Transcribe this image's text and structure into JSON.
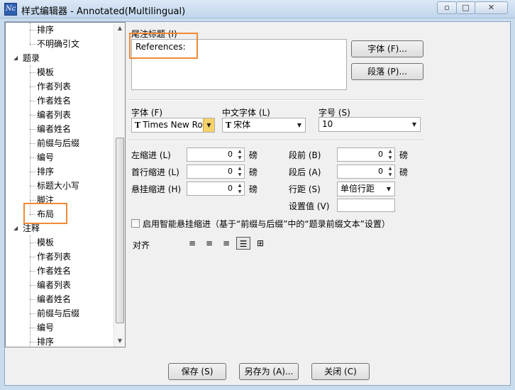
{
  "window": {
    "title": "样式编辑器 - Annotated(Multilingual)",
    "min_label": "▭",
    "max_label": "□",
    "close_label": "✕"
  },
  "tree": {
    "items": [
      {
        "label": "排序",
        "level": 2
      },
      {
        "label": "不明确引文",
        "level": 2
      },
      {
        "label": "题录",
        "level": 1
      },
      {
        "label": "模板",
        "level": 2
      },
      {
        "label": "作者列表",
        "level": 2
      },
      {
        "label": "作者姓名",
        "level": 2
      },
      {
        "label": "编者列表",
        "level": 2
      },
      {
        "label": "编者姓名",
        "level": 2
      },
      {
        "label": "前缀与后缀",
        "level": 2
      },
      {
        "label": "编号",
        "level": 2
      },
      {
        "label": "排序",
        "level": 2
      },
      {
        "label": "标题大小写",
        "level": 2
      },
      {
        "label": "脚注",
        "level": 2
      },
      {
        "label": "布局",
        "level": 2,
        "selected": true
      },
      {
        "label": "注释",
        "level": 1
      },
      {
        "label": "模板",
        "level": 2
      },
      {
        "label": "作者列表",
        "level": 2
      },
      {
        "label": "作者姓名",
        "level": 2
      },
      {
        "label": "编者列表",
        "level": 2
      },
      {
        "label": "编者姓名",
        "level": 2
      },
      {
        "label": "前缀与后缀",
        "level": 2
      },
      {
        "label": "编号",
        "level": 2
      },
      {
        "label": "排序",
        "level": 2
      }
    ]
  },
  "endnote_title": {
    "label": "尾注标题 (I)",
    "value": "References:",
    "font_button": "字体 (F)...",
    "paragraph_button": "段落 (P)..."
  },
  "font": {
    "font_label": "字体 (F)",
    "font_value": "Times New Ro",
    "cjk_font_label": "中文字体 (L)",
    "cjk_font_value": "宋体",
    "size_label": "字号 (S)",
    "size_value": "10"
  },
  "indent": {
    "left_label": "左缩进 (L)",
    "left_value": "0",
    "first_label": "首行缩进 (L)",
    "first_value": "0",
    "hanging_label": "悬挂缩进 (H)",
    "hanging_value": "0",
    "unit": "磅"
  },
  "spacing": {
    "before_label": "段前 (B)",
    "before_value": "0",
    "after_label": "段后 (A)",
    "after_value": "0",
    "line_label": "行距 (S)",
    "line_value": "单倍行距",
    "set_label": "设置值 (V)",
    "set_value": "",
    "unit": "磅"
  },
  "smart_hanging": {
    "label": "启用智能悬挂缩进（基于“前缀与后缀”中的“题录前缀文本”设置）",
    "checked": false
  },
  "alignment": {
    "label": "对齐",
    "selected": "justify"
  },
  "footer": {
    "save_button": "保存 (S)",
    "save_as_button": "另存为 (A)...",
    "close_button": "关闭 (C)"
  },
  "highlight_color": "#f08a35"
}
